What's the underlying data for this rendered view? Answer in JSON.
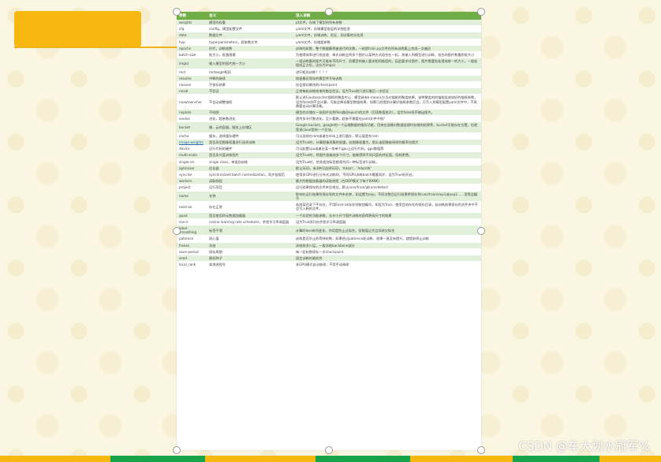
{
  "table": {
    "headers": [
      "参数",
      "含义",
      "深入讲解"
    ],
    "rows": [
      [
        "weights",
        "模型的权重",
        "pt文件，存储了模型的所有参数"
      ],
      [
        "cfg",
        "config，模型配置文件",
        "yaml文件，存储模型各层的详细信息"
      ],
      [
        "data",
        "数据文件",
        "yaml文件，存储训练、验证、测试集地址信息"
      ],
      [
        "hyp",
        "hyperparameters，超参数文件",
        "yaml文件，存储超参数"
      ],
      [
        "epochs",
        "时代，训练轮数",
        "训练的轮数，整个数据集将被迭代的次数，一轮即train.py文件在所有训练集上完成一次遍历"
      ],
      [
        "batch-size",
        "批大小，批量规模",
        "为使得效率进行批处理，单次训练会将多个图片以某种方式组合在一起，其输入到模型进行训练，组合的图片数量即批大小"
      ],
      [
        "imgsz",
        "输入模型的图片统一大小",
        "一组训练集的图片可能有不同尺寸，而模型的输入要求相同维度的，因此要求对图片，图片需要先处理成统一的大小，一般处理成正方形，边长为imgsz"
      ],
      [
        "rect",
        "rectangle矩形",
        "进行矩形训练？？？？"
      ],
      [
        "resume",
        "中断的继续",
        "恢复最近保存的模型并开始训练"
      ],
      [
        "nosave",
        "不保存结果",
        "仅会保存最终的checkpoint"
      ],
      [
        "noval",
        "不验证",
        "正常每轮训练结束时都会验证，设为True则只进行最后一次验证"
      ],
      [
        "noautoanchor",
        "不自动调整锚框",
        "默认进行autoanchor锚框的聚类中心，模型具有k-means方法对锚框的聚类结果，该种聚类的的锚框组成较好的锚框参数，设为false则不会计算，可能会降低模型数据效果，如果已经提前计算好锚框参数后会，可写入到模型配置yaml文件中，不再需要自动计算功能。"
      ],
      [
        "noplots",
        "不绘图",
        "模型也存储在一张图片化到files路径epoch的文件（后续数值依次），设为false则不输出图片。"
      ],
      [
        "evolve",
        "进化，超参数进化",
        "遗传多次代数进化，至少要跑，超参不需要在yaml文件中指？"
      ],
      [
        "bucket",
        "桶，云的容器，服务上存储区",
        "Google bucket，google的一个云端数据的服务功能，用来在该桶对数据处理时存储的结果等，bucket可能存在位置，也就是说cloud里的一个区块。"
      ],
      [
        "cache",
        "缓存，选择缓存硬件",
        "可以选择在ram或者在disk上进行缓存，默认值是在ram"
      ],
      [
        "image-weights",
        "是否采用图像权重进行选择训练",
        "设为True时，计算图像采集的权重，若图像权重大，那么该图像被采样的概率也就大"
      ],
      [
        "device",
        "运行代码的硬件",
        "可以配置cpu或者在某一块单个gpu上运行代码，gpu数值等"
      ],
      [
        "multi-scale",
        "是否多尺度训练图片",
        "设为True时，将图片放缩成多个尺寸，能够得到不同尺度的特征值，但耗更费。"
      ],
      [
        "single-cls",
        "single class，单类别训练",
        "设为True时，把多类别标签都视为同一种标签进行训练。"
      ],
      [
        "optimizer",
        "优化器",
        "默认SGD，有3种可选择SGD，'Adam'，'AdamW'"
      ],
      [
        "sync-bn",
        "synchronized batch normalization，同步批规范",
        "使用多GPU进行分布式训练时，不同GPU训练batch需要同步，设为True则开启。"
      ],
      [
        "workers",
        "读取线程",
        "最大的数据加载器的读取线程（在DDP模式下每个RANK）"
      ],
      [
        "project",
        "运行项目",
        "运行结果保存的文件夹总地址，默认runs/train/或runs/detect"
      ],
      [
        "name",
        "名称",
        "影响在运行结果所保存到的文件夹名称，如设置为exp，不同次数目运行结果将保存到runs/train/exp1或exp2……用等会编号"
      ],
      [
        "exist-ok",
        "存在正常",
        "若前某目录下不存在，不用Exist-ok存在则按加编号，如设为True，使用目前存在的保存目录，若训练结果保存的文件夹中不会写入新的文件。"
      ],
      [
        "quad",
        "是否使用四元数据加载器",
        "一个实验性功能参数，允许小尺寸图片训练时获得更高尺寸的效果"
      ],
      [
        "cos-lr",
        "cosine learning rate scheduler，余弦学习率调度器",
        "设为True则开启余弦学习率调度器"
      ],
      [
        "label-smoothing",
        "标签平滑",
        "计算的loss有所变化，作用是防止过拟合，但数值过大会导致欠拟合"
      ],
      [
        "patience",
        "耐心值",
        "训练是否早止的等待轮数，如果经过patience轮训练，效果一直没有提升，就提前停止训练"
      ],
      [
        "freeze",
        "冻结",
        "冻结前多少层，一般冻结backbone部分"
      ],
      [
        "save-period",
        "保存周期",
        "每一定轮数保存一次checkpoint"
      ],
      [
        "seed",
        "随机种子",
        "固定训练的随机性"
      ],
      [
        "local_rank",
        "本地进程号",
        "多GPU模式自动修改，不用手动修改"
      ]
    ]
  },
  "watermark": "CSDN @车大划水冠军%",
  "colors": {
    "header_green": "#70ad47",
    "row_green": "#e2efda",
    "orange": "#f7b90f",
    "bottom_bar": [
      "#f7b90f",
      "#16a34a",
      "#f7b90f",
      "#16a34a",
      "#f7b90f",
      "#16a34a",
      "#f7b90f"
    ]
  }
}
